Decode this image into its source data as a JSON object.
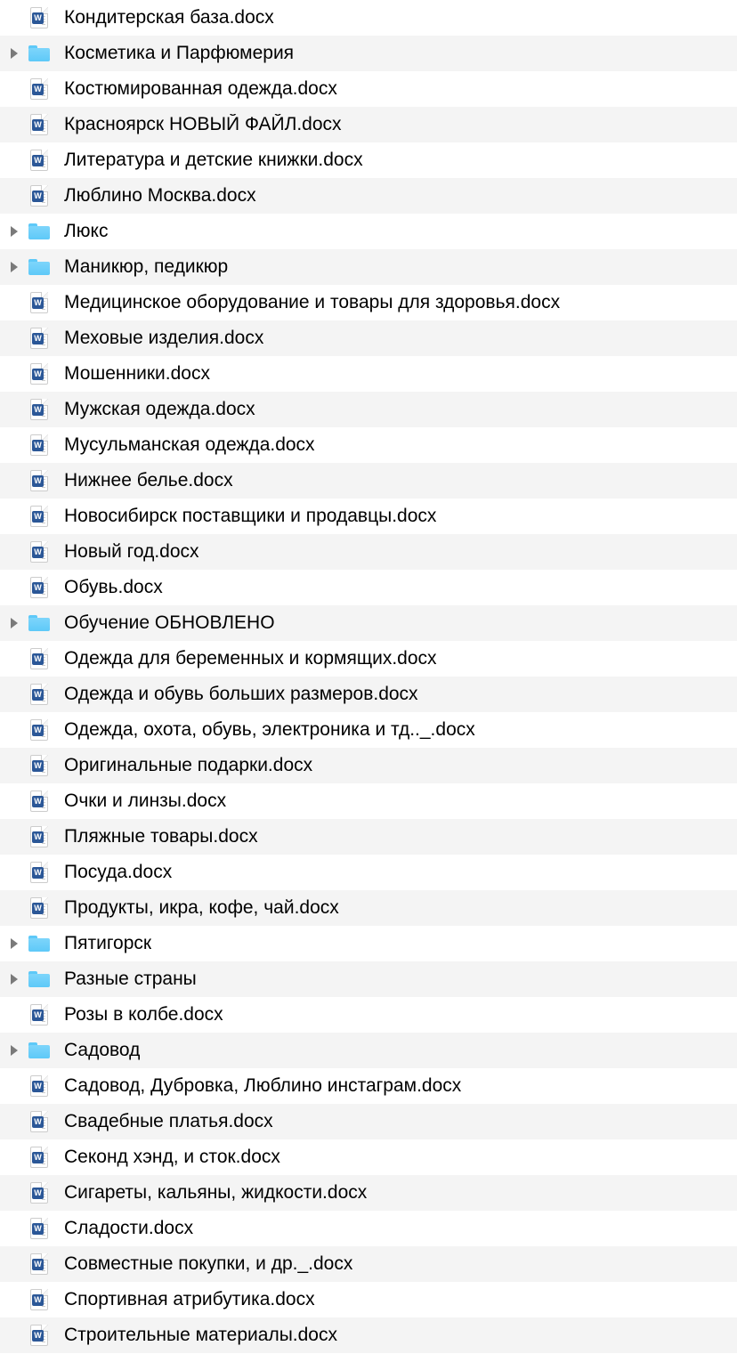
{
  "items": [
    {
      "type": "docx",
      "name": "Кондитерская база.docx",
      "alt": false
    },
    {
      "type": "folder",
      "name": "Косметика и Парфюмерия",
      "alt": true
    },
    {
      "type": "docx",
      "name": "Костюмированная одежда.docx",
      "alt": false
    },
    {
      "type": "docx",
      "name": "Красноярск НОВЫЙ ФАЙЛ.docx",
      "alt": true
    },
    {
      "type": "docx",
      "name": "Литература и детские книжки.docx",
      "alt": false
    },
    {
      "type": "docx",
      "name": "Люблино Москва.docx",
      "alt": true
    },
    {
      "type": "folder",
      "name": "Люкс",
      "alt": false
    },
    {
      "type": "folder",
      "name": "Маникюр, педикюр",
      "alt": true
    },
    {
      "type": "docx",
      "name": "Медицинское оборудование и товары для здоровья.docx",
      "alt": false
    },
    {
      "type": "docx",
      "name": "Меховые изделия.docx",
      "alt": true
    },
    {
      "type": "docx",
      "name": "Мошенники.docx",
      "alt": false
    },
    {
      "type": "docx",
      "name": "Мужская одежда.docx",
      "alt": true
    },
    {
      "type": "docx",
      "name": "Мусульманская одежда.docx",
      "alt": false
    },
    {
      "type": "docx",
      "name": "Нижнее белье.docx",
      "alt": true
    },
    {
      "type": "docx",
      "name": "Новосибирск поставщики и продавцы.docx",
      "alt": false
    },
    {
      "type": "docx",
      "name": "Новый год.docx",
      "alt": true
    },
    {
      "type": "docx",
      "name": "Обувь.docx",
      "alt": false
    },
    {
      "type": "folder",
      "name": "Обучение ОБНОВЛЕНО",
      "alt": true
    },
    {
      "type": "docx",
      "name": "Одежда для беременных и кормящих.docx",
      "alt": false
    },
    {
      "type": "docx",
      "name": "Одежда и обувь больших размеров.docx",
      "alt": true
    },
    {
      "type": "docx",
      "name": "Одежда, охота, обувь, электроника и тд.._.docx",
      "alt": false
    },
    {
      "type": "docx",
      "name": "Оригинальные подарки.docx",
      "alt": true
    },
    {
      "type": "docx",
      "name": "Очки и линзы.docx",
      "alt": false
    },
    {
      "type": "docx",
      "name": "Пляжные товары.docx",
      "alt": true
    },
    {
      "type": "docx",
      "name": "Посуда.docx",
      "alt": false
    },
    {
      "type": "docx",
      "name": "Продукты, икра, кофе, чай.docx",
      "alt": true
    },
    {
      "type": "folder",
      "name": "Пятигорск",
      "alt": false
    },
    {
      "type": "folder",
      "name": "Разные страны",
      "alt": true
    },
    {
      "type": "docx",
      "name": "Розы в колбе.docx",
      "alt": false
    },
    {
      "type": "folder",
      "name": "Садовод",
      "alt": true
    },
    {
      "type": "docx",
      "name": "Садовод, Дубровка, Люблино инстаграм.docx",
      "alt": false
    },
    {
      "type": "docx",
      "name": "Свадебные платья.docx",
      "alt": true
    },
    {
      "type": "docx",
      "name": "Секонд хэнд, и сток.docx",
      "alt": false
    },
    {
      "type": "docx",
      "name": "Сигареты, кальяны, жидкости.docx",
      "alt": true
    },
    {
      "type": "docx",
      "name": "Сладости.docx",
      "alt": false
    },
    {
      "type": "docx",
      "name": "Совместные покупки, и др._.docx",
      "alt": true
    },
    {
      "type": "docx",
      "name": "Спортивная атрибутика.docx",
      "alt": false
    },
    {
      "type": "docx",
      "name": "Строительные материалы.docx",
      "alt": true
    }
  ]
}
